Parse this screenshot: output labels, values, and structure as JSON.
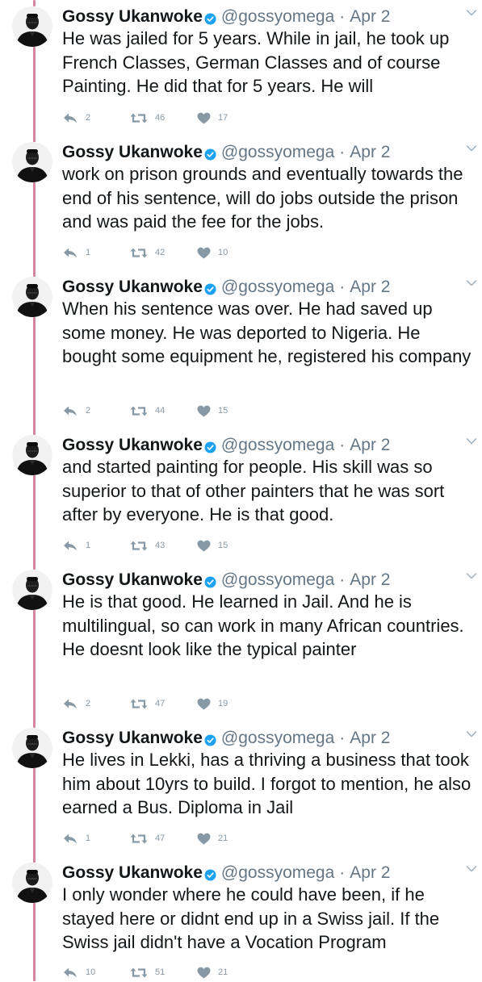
{
  "colors": {
    "thread_line": "#d4869f",
    "verified": "#1da1f2",
    "muted": "#657786",
    "action": "#8899a6"
  },
  "icons": {
    "verified": "verified-badge-icon",
    "caret": "chevron-down-icon",
    "reply": "reply-icon",
    "retweet": "retweet-icon",
    "like": "heart-icon"
  },
  "tweets": [
    {
      "name": "Gossy Ukanwoke",
      "handle": "@gossyomega",
      "separator": "·",
      "date": "Apr 2",
      "text": "He was jailed for 5 years. While in jail, he took up French Classes, German Classes and of course Painting. He did that for 5 years. He will",
      "replies": "2",
      "retweets": "46",
      "likes": "17"
    },
    {
      "name": "Gossy Ukanwoke",
      "handle": "@gossyomega",
      "separator": "·",
      "date": "Apr 2",
      "text": "work on prison grounds and eventually towards the end of his sentence, will do jobs outside the prison and was paid the fee for the jobs.",
      "replies": "1",
      "retweets": "42",
      "likes": "10"
    },
    {
      "name": "Gossy Ukanwoke",
      "handle": "@gossyomega",
      "separator": "·",
      "date": "Apr 2",
      "text": "When his sentence was over. He had saved up some money. He was deported to Nigeria. He bought some equipment he, registered his company",
      "replies": "2",
      "retweets": "44",
      "likes": "15"
    },
    {
      "name": "Gossy Ukanwoke",
      "handle": "@gossyomega",
      "separator": "·",
      "date": "Apr 2",
      "text": "and started painting for people. His skill was so superior to that of other painters that he was sort after by everyone. He is that good.",
      "replies": "1",
      "retweets": "43",
      "likes": "15"
    },
    {
      "name": "Gossy Ukanwoke",
      "handle": "@gossyomega",
      "separator": "·",
      "date": "Apr 2",
      "text": "He is that good. He learned in Jail. And he is multilingual, so can work in many African countries. He doesnt look like the typical painter",
      "replies": "2",
      "retweets": "47",
      "likes": "19"
    },
    {
      "name": "Gossy Ukanwoke",
      "handle": "@gossyomega",
      "separator": "·",
      "date": "Apr 2",
      "text": "He lives in Lekki, has a thriving a business that took him about 10yrs to build.  I forgot to mention, he also earned a Bus. Diploma in Jail",
      "replies": "1",
      "retweets": "47",
      "likes": "21"
    },
    {
      "name": "Gossy Ukanwoke",
      "handle": "@gossyomega",
      "separator": "·",
      "date": "Apr 2",
      "text": "I only wonder where he could have been, if he stayed here or didnt end up in a Swiss jail. If the Swiss jail didn't have a Vocation Program",
      "replies": "10",
      "retweets": "51",
      "likes": "21"
    }
  ]
}
